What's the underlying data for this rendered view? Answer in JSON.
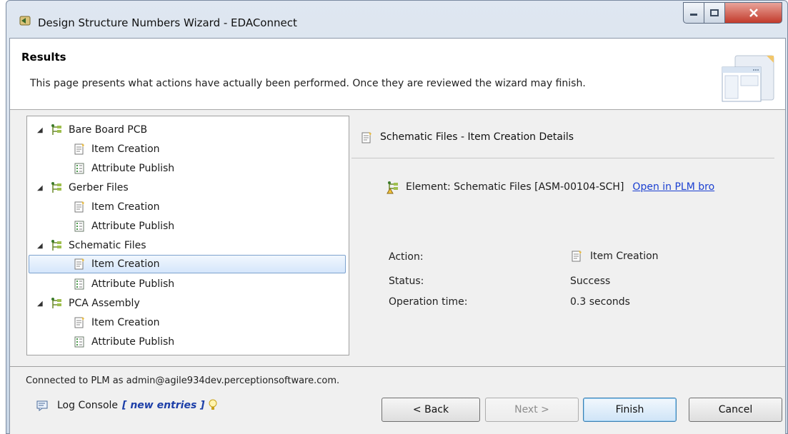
{
  "window": {
    "title": "Design Structure Numbers Wizard - EDAConnect"
  },
  "header": {
    "title": "Results",
    "description": "This page presents what actions have actually been performed. Once they are reviewed the wizard may finish."
  },
  "tree": {
    "nodes": [
      {
        "label": "Bare Board PCB",
        "children": [
          "Item Creation",
          "Attribute Publish"
        ]
      },
      {
        "label": "Gerber Files",
        "children": [
          "Item Creation",
          "Attribute Publish"
        ]
      },
      {
        "label": "Schematic Files",
        "children": [
          "Item Creation",
          "Attribute Publish"
        ]
      },
      {
        "label": "PCA Assembly",
        "children": [
          "Item Creation",
          "Attribute Publish"
        ]
      }
    ],
    "selected": "Schematic Files > Item Creation"
  },
  "details": {
    "header": "Schematic Files - Item Creation Details",
    "element_text": "Element: Schematic Files [ASM-00104-SCH]",
    "element_link": "Open in PLM bro",
    "action_label": "Action:",
    "action_value": "Item Creation",
    "status_label": "Status:",
    "status_value": "Success",
    "time_label": "Operation time:",
    "time_value": "0.3 seconds"
  },
  "footer": {
    "connection": "Connected to PLM as admin@agile934dev.perceptionsoftware.com.",
    "log_label": "Log Console",
    "log_new": "[ new entries ]",
    "back": "< Back",
    "next": "Next >",
    "finish": "Finish",
    "cancel": "Cancel"
  },
  "colors": {
    "link": "#1a3fd1",
    "selection_border": "#7da2ce",
    "new_entries": "#1d3fa8"
  }
}
